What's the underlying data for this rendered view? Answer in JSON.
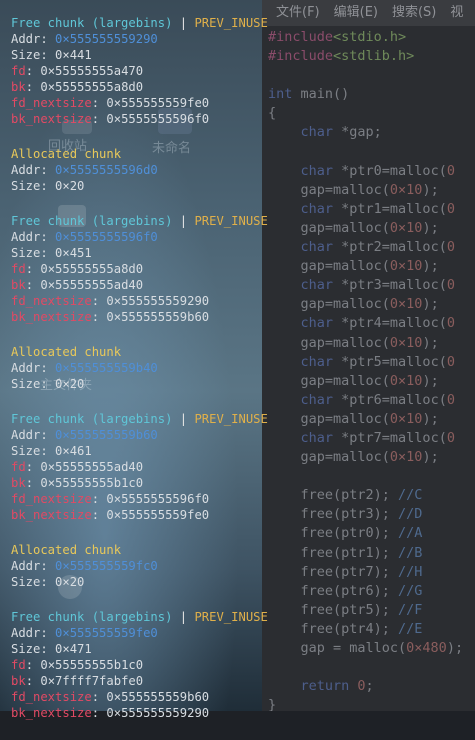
{
  "editor": {
    "menu": [
      "文件(F)",
      "编辑(E)",
      "搜索(S)",
      "视"
    ],
    "code_lines": [
      [
        {
          "c": "inc",
          "t": "#include"
        },
        {
          "c": "str",
          "t": "<stdio.h>"
        }
      ],
      [
        {
          "c": "inc",
          "t": "#include"
        },
        {
          "c": "str",
          "t": "<stdlib.h>"
        }
      ],
      [],
      [
        {
          "c": "kw",
          "t": "int"
        },
        {
          "c": "fn",
          "t": " main()"
        }
      ],
      [
        {
          "c": "fn",
          "t": "{"
        }
      ],
      [
        {
          "c": "kw",
          "t": "    char"
        },
        {
          "c": "fn",
          "t": " *gap;"
        }
      ],
      [],
      [
        {
          "c": "kw",
          "t": "    char"
        },
        {
          "c": "fn",
          "t": " *ptr0=malloc("
        },
        {
          "c": "num",
          "t": "0"
        }
      ],
      [
        {
          "c": "fn",
          "t": "    gap=malloc("
        },
        {
          "c": "num",
          "t": "0×10"
        },
        {
          "c": "fn",
          "t": ");"
        }
      ],
      [
        {
          "c": "kw",
          "t": "    char"
        },
        {
          "c": "fn",
          "t": " *ptr1=malloc("
        },
        {
          "c": "num",
          "t": "0"
        }
      ],
      [
        {
          "c": "fn",
          "t": "    gap=malloc("
        },
        {
          "c": "num",
          "t": "0×10"
        },
        {
          "c": "fn",
          "t": ");"
        }
      ],
      [
        {
          "c": "kw",
          "t": "    char"
        },
        {
          "c": "fn",
          "t": " *ptr2=malloc("
        },
        {
          "c": "num",
          "t": "0"
        }
      ],
      [
        {
          "c": "fn",
          "t": "    gap=malloc("
        },
        {
          "c": "num",
          "t": "0×10"
        },
        {
          "c": "fn",
          "t": ");"
        }
      ],
      [
        {
          "c": "kw",
          "t": "    char"
        },
        {
          "c": "fn",
          "t": " *ptr3=malloc("
        },
        {
          "c": "num",
          "t": "0"
        }
      ],
      [
        {
          "c": "fn",
          "t": "    gap=malloc("
        },
        {
          "c": "num",
          "t": "0×10"
        },
        {
          "c": "fn",
          "t": ");"
        }
      ],
      [
        {
          "c": "kw",
          "t": "    char"
        },
        {
          "c": "fn",
          "t": " *ptr4=malloc("
        },
        {
          "c": "num",
          "t": "0"
        }
      ],
      [
        {
          "c": "fn",
          "t": "    gap=malloc("
        },
        {
          "c": "num",
          "t": "0×10"
        },
        {
          "c": "fn",
          "t": ");"
        }
      ],
      [
        {
          "c": "kw",
          "t": "    char"
        },
        {
          "c": "fn",
          "t": " *ptr5=malloc("
        },
        {
          "c": "num",
          "t": "0"
        }
      ],
      [
        {
          "c": "fn",
          "t": "    gap=malloc("
        },
        {
          "c": "num",
          "t": "0×10"
        },
        {
          "c": "fn",
          "t": ");"
        }
      ],
      [
        {
          "c": "kw",
          "t": "    char"
        },
        {
          "c": "fn",
          "t": " *ptr6=malloc("
        },
        {
          "c": "num",
          "t": "0"
        }
      ],
      [
        {
          "c": "fn",
          "t": "    gap=malloc("
        },
        {
          "c": "num",
          "t": "0×10"
        },
        {
          "c": "fn",
          "t": ");"
        }
      ],
      [
        {
          "c": "kw",
          "t": "    char"
        },
        {
          "c": "fn",
          "t": " *ptr7=malloc("
        },
        {
          "c": "num",
          "t": "0"
        }
      ],
      [
        {
          "c": "fn",
          "t": "    gap=malloc("
        },
        {
          "c": "num",
          "t": "0×10"
        },
        {
          "c": "fn",
          "t": ");"
        }
      ],
      [],
      [
        {
          "c": "fn",
          "t": "    free(ptr2); "
        },
        {
          "c": "cm",
          "t": "//C"
        }
      ],
      [
        {
          "c": "fn",
          "t": "    free(ptr3); "
        },
        {
          "c": "cm",
          "t": "//D"
        }
      ],
      [
        {
          "c": "fn",
          "t": "    free(ptr0); "
        },
        {
          "c": "cm",
          "t": "//A"
        }
      ],
      [
        {
          "c": "fn",
          "t": "    free(ptr1); "
        },
        {
          "c": "cm",
          "t": "//B"
        }
      ],
      [
        {
          "c": "fn",
          "t": "    free(ptr7); "
        },
        {
          "c": "cm",
          "t": "//H"
        }
      ],
      [
        {
          "c": "fn",
          "t": "    free(ptr6); "
        },
        {
          "c": "cm",
          "t": "//G"
        }
      ],
      [
        {
          "c": "fn",
          "t": "    free(ptr5); "
        },
        {
          "c": "cm",
          "t": "//F"
        }
      ],
      [
        {
          "c": "fn",
          "t": "    free(ptr4); "
        },
        {
          "c": "cm",
          "t": "//E"
        }
      ],
      [
        {
          "c": "fn",
          "t": "    gap = malloc("
        },
        {
          "c": "num",
          "t": "0×480"
        },
        {
          "c": "fn",
          "t": ");"
        }
      ],
      [],
      [
        {
          "c": "kw",
          "t": "    return"
        },
        {
          "c": "num",
          "t": " 0"
        },
        {
          "c": "fn",
          "t": ";"
        }
      ],
      [
        {
          "c": "fn",
          "t": "}"
        }
      ]
    ]
  },
  "wallpaper_labels": [
    "回收站",
    "未命名",
    "主文件夹"
  ],
  "heap_blocks": [
    {
      "type": "free",
      "title": "Free chunk (largebins)",
      "sep": " | ",
      "flag": "PREV_INUSE",
      "fields": [
        {
          "k": "Addr: ",
          "kc": "plain",
          "v": "0×555555559290",
          "vc": "blue"
        },
        {
          "k": "Size: ",
          "kc": "plain",
          "v": "0×441",
          "vc": "plain"
        },
        {
          "k": "fd",
          "kc": "red",
          "v": ": 0×55555555a470",
          "vc": "plain"
        },
        {
          "k": "bk",
          "kc": "red",
          "v": ": 0×55555555a8d0",
          "vc": "plain"
        },
        {
          "k": "fd_nextsize",
          "kc": "red",
          "v": ": 0×555555559fe0",
          "vc": "plain"
        },
        {
          "k": "bk_nextsize",
          "kc": "red",
          "v": ": 0×5555555596f0",
          "vc": "plain"
        }
      ]
    },
    {
      "type": "alloc",
      "title": "Allocated chunk",
      "fields": [
        {
          "k": "Addr: ",
          "kc": "plain",
          "v": "0×5555555596d0",
          "vc": "blue"
        },
        {
          "k": "Size: ",
          "kc": "plain",
          "v": "0×20",
          "vc": "plain"
        }
      ]
    },
    {
      "type": "free",
      "title": "Free chunk (largebins)",
      "sep": " | ",
      "flag": "PREV_INUSE",
      "fields": [
        {
          "k": "Addr: ",
          "kc": "plain",
          "v": "0×5555555596f0",
          "vc": "blue"
        },
        {
          "k": "Size: ",
          "kc": "plain",
          "v": "0×451",
          "vc": "plain"
        },
        {
          "k": "fd",
          "kc": "red",
          "v": ": 0×55555555a8d0",
          "vc": "plain"
        },
        {
          "k": "bk",
          "kc": "red",
          "v": ": 0×55555555ad40",
          "vc": "plain"
        },
        {
          "k": "fd_nextsize",
          "kc": "red",
          "v": ": 0×555555559290",
          "vc": "plain"
        },
        {
          "k": "bk_nextsize",
          "kc": "red",
          "v": ": 0×555555559b60",
          "vc": "plain"
        }
      ]
    },
    {
      "type": "alloc",
      "title": "Allocated chunk",
      "fields": [
        {
          "k": "Addr: ",
          "kc": "plain",
          "v": "0×555555559b40",
          "vc": "blue"
        },
        {
          "k": "Size: ",
          "kc": "plain",
          "v": "0×20",
          "vc": "plain"
        }
      ]
    },
    {
      "type": "free",
      "title": "Free chunk (largebins)",
      "sep": " | ",
      "flag": "PREV_INUSE",
      "fields": [
        {
          "k": "Addr: ",
          "kc": "plain",
          "v": "0×555555559b60",
          "vc": "blue"
        },
        {
          "k": "Size: ",
          "kc": "plain",
          "v": "0×461",
          "vc": "plain"
        },
        {
          "k": "fd",
          "kc": "red",
          "v": ": 0×55555555ad40",
          "vc": "plain"
        },
        {
          "k": "bk",
          "kc": "red",
          "v": ": 0×55555555b1c0",
          "vc": "plain"
        },
        {
          "k": "fd_nextsize",
          "kc": "red",
          "v": ": 0×5555555596f0",
          "vc": "plain"
        },
        {
          "k": "bk_nextsize",
          "kc": "red",
          "v": ": 0×555555559fe0",
          "vc": "plain"
        }
      ]
    },
    {
      "type": "alloc",
      "title": "Allocated chunk",
      "fields": [
        {
          "k": "Addr: ",
          "kc": "plain",
          "v": "0×555555559fc0",
          "vc": "blue"
        },
        {
          "k": "Size: ",
          "kc": "plain",
          "v": "0×20",
          "vc": "plain"
        }
      ]
    },
    {
      "type": "free",
      "title": "Free chunk (largebins)",
      "sep": " | ",
      "flag": "PREV_INUSE",
      "fields": [
        {
          "k": "Addr: ",
          "kc": "plain",
          "v": "0×555555559fe0",
          "vc": "blue"
        },
        {
          "k": "Size: ",
          "kc": "plain",
          "v": "0×471",
          "vc": "plain"
        },
        {
          "k": "fd",
          "kc": "red",
          "v": ": 0×55555555b1c0",
          "vc": "plain"
        },
        {
          "k": "bk",
          "kc": "red",
          "v": ": 0×7ffff7fabfe0",
          "vc": "plain"
        },
        {
          "k": "fd_nextsize",
          "kc": "red",
          "v": ": 0×555555559b60",
          "vc": "plain"
        },
        {
          "k": "bk_nextsize",
          "kc": "red",
          "v": ": 0×555555559290",
          "vc": "plain"
        }
      ]
    }
  ]
}
